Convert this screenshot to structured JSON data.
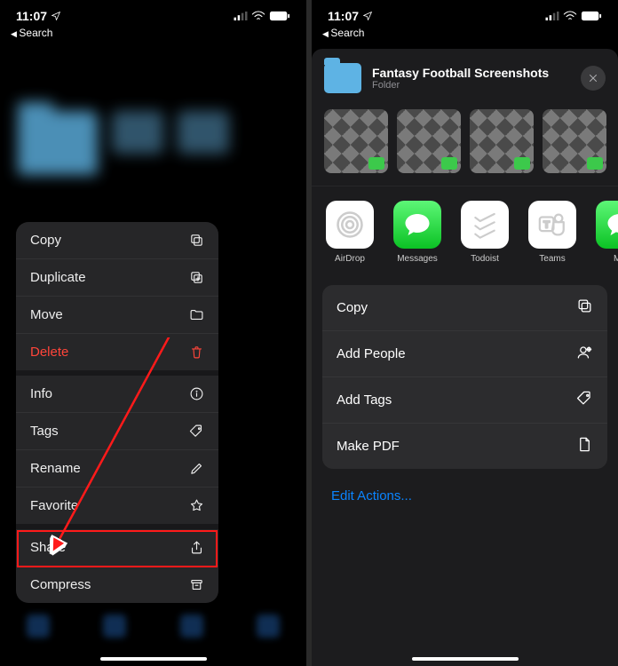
{
  "status": {
    "time": "11:07",
    "back_label": "Search"
  },
  "left": {
    "menu": [
      {
        "label": "Copy",
        "icon": "copy-icon",
        "danger": false,
        "sep": false
      },
      {
        "label": "Duplicate",
        "icon": "duplicate-icon",
        "danger": false,
        "sep": false
      },
      {
        "label": "Move",
        "icon": "folder-icon",
        "danger": false,
        "sep": false
      },
      {
        "label": "Delete",
        "icon": "trash-icon",
        "danger": true,
        "sep": true
      },
      {
        "label": "Info",
        "icon": "info-icon",
        "danger": false,
        "sep": false
      },
      {
        "label": "Tags",
        "icon": "tag-icon",
        "danger": false,
        "sep": false
      },
      {
        "label": "Rename",
        "icon": "pencil-icon",
        "danger": false,
        "sep": false
      },
      {
        "label": "Favorite",
        "icon": "star-icon",
        "danger": false,
        "sep": true
      },
      {
        "label": "Share",
        "icon": "share-icon",
        "danger": false,
        "sep": false
      },
      {
        "label": "Compress",
        "icon": "archive-icon",
        "danger": false,
        "sep": false
      }
    ]
  },
  "right": {
    "sheet": {
      "title": "Fantasy Football Screenshots",
      "subtitle": "Folder"
    },
    "apps": [
      {
        "name": "AirDrop",
        "kind": "airdrop"
      },
      {
        "name": "Messages",
        "kind": "messages"
      },
      {
        "name": "Todoist",
        "kind": "todoist"
      },
      {
        "name": "Teams",
        "kind": "teams"
      },
      {
        "name": "Me",
        "kind": "more"
      }
    ],
    "actions": [
      {
        "label": "Copy",
        "icon": "copy-icon"
      },
      {
        "label": "Add People",
        "icon": "add-people-icon"
      },
      {
        "label": "Add Tags",
        "icon": "tag-icon"
      },
      {
        "label": "Make PDF",
        "icon": "document-icon"
      }
    ],
    "edit_label": "Edit Actions..."
  }
}
